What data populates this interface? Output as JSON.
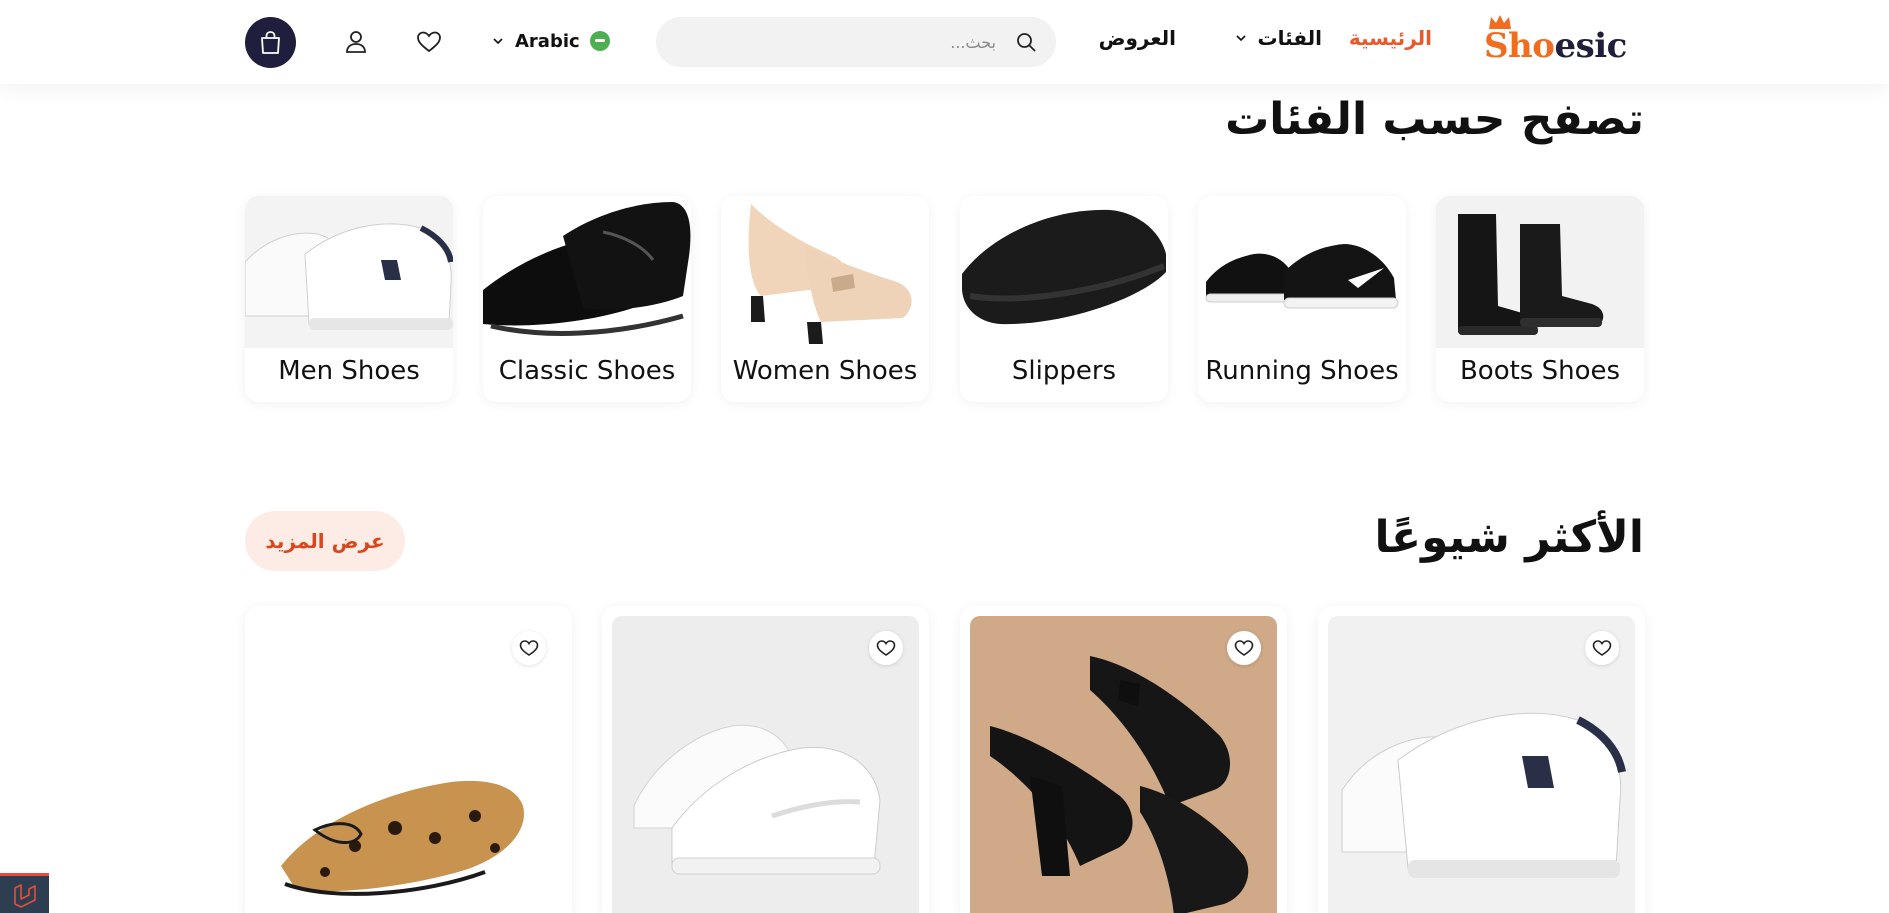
{
  "brand": {
    "logo_part1": "Sho",
    "logo_part2": "esic",
    "accent": "#f06d1f",
    "dark": "#1f1f3d"
  },
  "nav": {
    "home": "الرئيسية",
    "categories": "الفئات",
    "offers": "العروض"
  },
  "search": {
    "placeholder": "بحث..."
  },
  "language": {
    "label": "Arabic"
  },
  "icons": [
    "search-icon",
    "user-icon",
    "heart-icon",
    "bag-icon",
    "chevron-down-icon"
  ],
  "categories_section": {
    "title": "تصفح حسب الفئات",
    "items": [
      {
        "label": "Boots Shoes"
      },
      {
        "label": "Running Shoes"
      },
      {
        "label": "Slippers"
      },
      {
        "label": "Women Shoes"
      },
      {
        "label": "Classic Shoes"
      },
      {
        "label": "Men Shoes"
      }
    ]
  },
  "popular_section": {
    "title": "الأكثر شيوعًا",
    "view_more": "عرض المزيد"
  },
  "colors": {
    "highlight": "#e85a2a",
    "view_more_bg": "#fdece6",
    "view_more_text": "#d9471c"
  }
}
